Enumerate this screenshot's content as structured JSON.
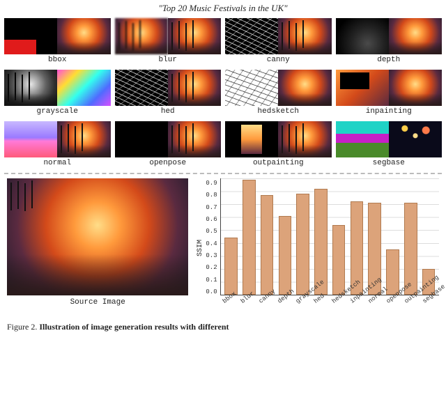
{
  "title": "\"Top 20 Music Festivals in the UK\"",
  "conditions": [
    {
      "key": "bbox",
      "label": "bbox",
      "left": "bbox",
      "right": "stage"
    },
    {
      "key": "blur",
      "label": "blur",
      "left": "festival-blur",
      "right": "festival"
    },
    {
      "key": "canny",
      "label": "canny",
      "left": "lines-dark",
      "right": "festival"
    },
    {
      "key": "depth",
      "label": "depth",
      "left": "depth",
      "right": "festival-dark"
    },
    {
      "key": "grayscale",
      "label": "grayscale",
      "left": "festival-gray",
      "right": "gray-out"
    },
    {
      "key": "hed",
      "label": "hed",
      "left": "lines-dark",
      "right": "festival"
    },
    {
      "key": "hedsketch",
      "label": "hedsketch",
      "left": "lines-light",
      "right": "festival-dark"
    },
    {
      "key": "inpainting",
      "label": "inpainting",
      "left": "inpaint",
      "right": "stage"
    },
    {
      "key": "normal",
      "label": "normal",
      "left": "normal",
      "right": "festival"
    },
    {
      "key": "openpose",
      "label": "openpose",
      "left": "openpose",
      "right": "festival"
    },
    {
      "key": "outpainting",
      "label": "outpainting",
      "left": "outpaint",
      "right": "festival"
    },
    {
      "key": "segbase",
      "label": "segbase",
      "left": "seg",
      "right": "fireworks"
    }
  ],
  "source_label": "Source Image",
  "chart_data": {
    "type": "bar",
    "categories": [
      "bbox",
      "blur",
      "canny",
      "depth",
      "grayscale",
      "hed",
      "hedsketch",
      "inpainting",
      "normal",
      "openpose",
      "outpainting",
      "segbase"
    ],
    "values": [
      0.44,
      0.89,
      0.77,
      0.61,
      0.78,
      0.82,
      0.54,
      0.72,
      0.71,
      0.35,
      0.71,
      0.2
    ],
    "ylabel": "SSIM",
    "xlabel": "",
    "ylim": [
      0.0,
      0.9
    ],
    "yticks": [
      0.0,
      0.1,
      0.2,
      0.3,
      0.4,
      0.5,
      0.6,
      0.7,
      0.8,
      0.9
    ],
    "title": ""
  },
  "caption_prefix": "Figure 2. ",
  "caption_bold": "Illustration of image generation results with different"
}
